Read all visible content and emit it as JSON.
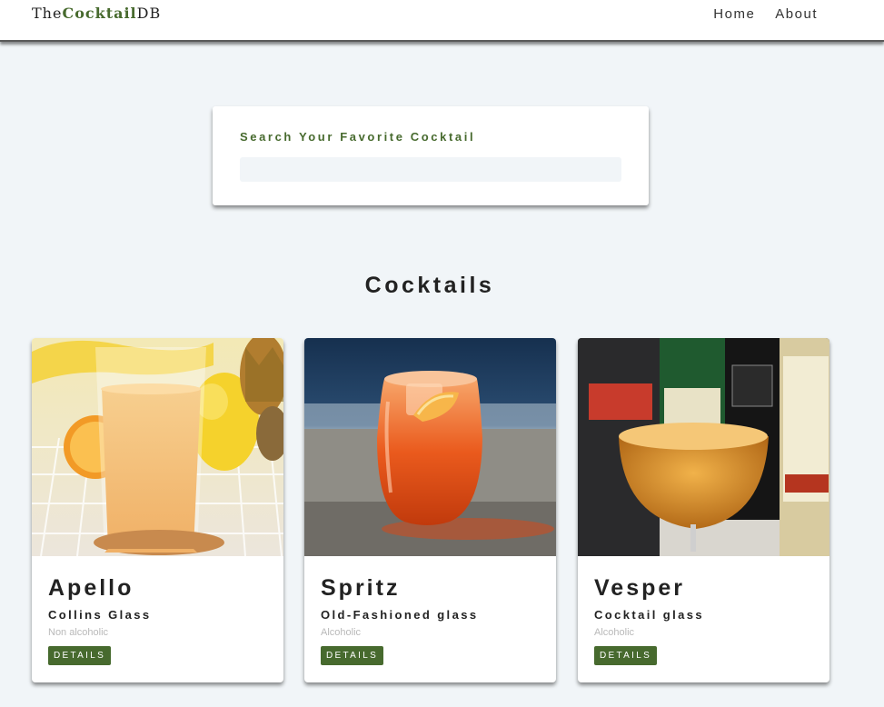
{
  "navbar": {
    "logo_prefix": "The",
    "logo_accent": "Cocktail",
    "logo_suffix": "DB",
    "links": [
      "Home",
      "About"
    ]
  },
  "search": {
    "label": "Search Your Favorite Cocktail",
    "value": ""
  },
  "section_title": "Cocktails",
  "cocktails": [
    {
      "name": "Apello",
      "glass": "Collins Glass",
      "info": "Non alcoholic",
      "button": "DETAILS",
      "image": "orange juice glass with fruit"
    },
    {
      "name": "Spritz",
      "glass": "Old-Fashioned glass",
      "info": "Alcoholic",
      "button": "DETAILS",
      "image": "orange spritz in stemless glass"
    },
    {
      "name": "Vesper",
      "glass": "Cocktail glass",
      "info": "Alcoholic",
      "button": "DETAILS",
      "image": "vesper martini with bottles"
    }
  ],
  "colors": {
    "accent": "#476a2e",
    "background": "#f1f5f8",
    "card": "#ffffff",
    "muted_text": "#b9b9b9"
  }
}
